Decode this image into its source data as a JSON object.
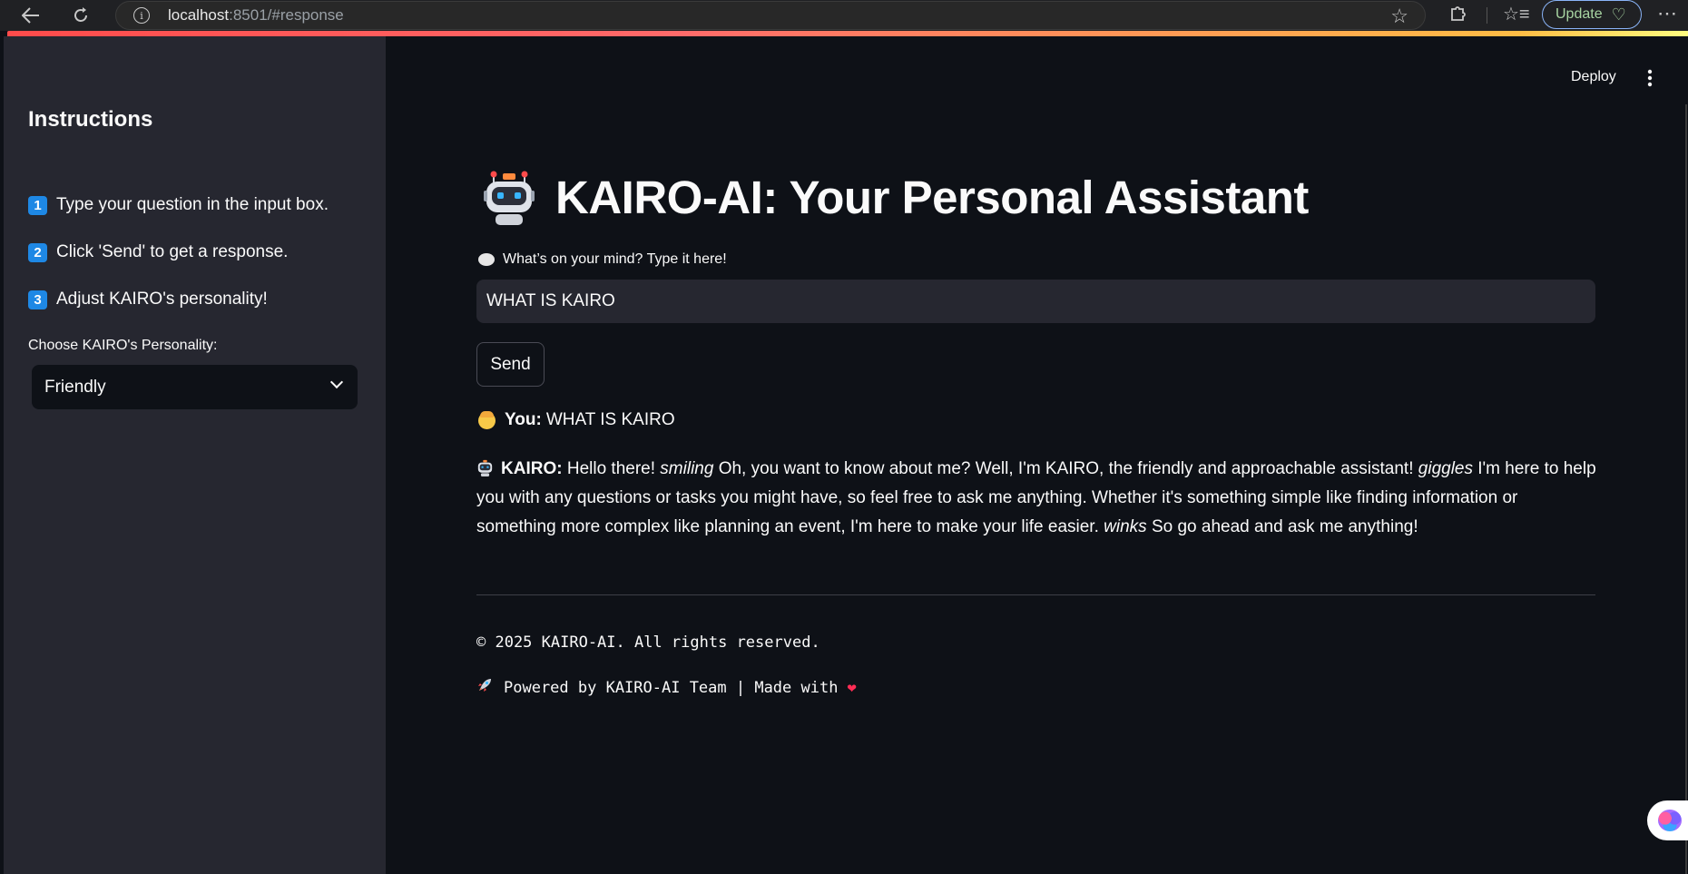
{
  "browser": {
    "url_host": "localhost",
    "url_rest": ":8501/#response",
    "update_label": "Update"
  },
  "sidebar": {
    "title": "Instructions",
    "items": [
      {
        "num": "1",
        "label": "Type your question in the input box."
      },
      {
        "num": "2",
        "label": "Click 'Send' to get a response."
      },
      {
        "num": "3",
        "label": "Adjust KAIRO's personality!"
      }
    ],
    "personality_label": "Choose KAIRO's Personality:",
    "personality_value": "Friendly"
  },
  "header": {
    "deploy_label": "Deploy"
  },
  "main": {
    "title": "KAIRO-AI: Your Personal Assistant",
    "input_label": "What’s on your mind? Type it here!",
    "input_value": "WHAT IS KAIRO",
    "send_label": "Send",
    "you_prefix": "You:",
    "you_text": "WHAT IS KAIRO",
    "kairo_prefix": "KAIRO:",
    "kairo_parts": {
      "p1": "Hello there! ",
      "e1": "smiling",
      "p2": " Oh, you want to know about me? Well, I'm KAIRO, the friendly and approachable assistant! ",
      "e2": "giggles",
      "p3": " I'm here to help you with any questions or tasks you might have, so feel free to ask me anything. Whether it's something simple like finding information or something more complex like planning an event, I'm here to make your life easier. ",
      "e3": "winks",
      "p4": " So go ahead and ask me anything!"
    },
    "footer_copyright": "© 2025 KAIRO-AI. All rights reserved.",
    "footer_powered": "Powered by KAIRO-AI Team | Made with"
  },
  "colors": {
    "app_bg": "#0e1117",
    "sidebar_bg": "#262730",
    "accent": "#ff4b4b",
    "keycap": "#1e88e5"
  },
  "icons": [
    "back-icon",
    "reload-icon",
    "info-icon",
    "star-icon",
    "extensions-icon",
    "favorites-icon",
    "more-icon",
    "robot-icon",
    "speech-bubble-icon",
    "person-icon",
    "rocket-icon",
    "heart-icon",
    "brain-icon",
    "chevron-down-icon"
  ]
}
